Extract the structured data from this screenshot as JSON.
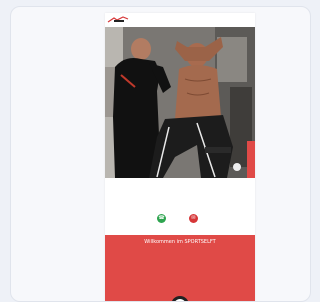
{
  "nav": {
    "logo_text": "",
    "links": [
      "",
      "",
      "",
      "",
      "",
      ""
    ]
  },
  "hero": {
    "alt": ""
  },
  "intro": {
    "line1": "",
    "line2": "",
    "line3": ""
  },
  "buttons": {
    "whatsapp_icon": "phone-icon",
    "email_icon": "email-icon"
  },
  "welcome": {
    "title": "Willkommen im SPORTSELFT",
    "subtitle": "",
    "text1": "",
    "text2": "",
    "text3": "",
    "text4": "",
    "text5": "",
    "text6": "",
    "text7": ""
  },
  "colors": {
    "brand_red": "#e04a47",
    "green": "#2ea44f"
  }
}
